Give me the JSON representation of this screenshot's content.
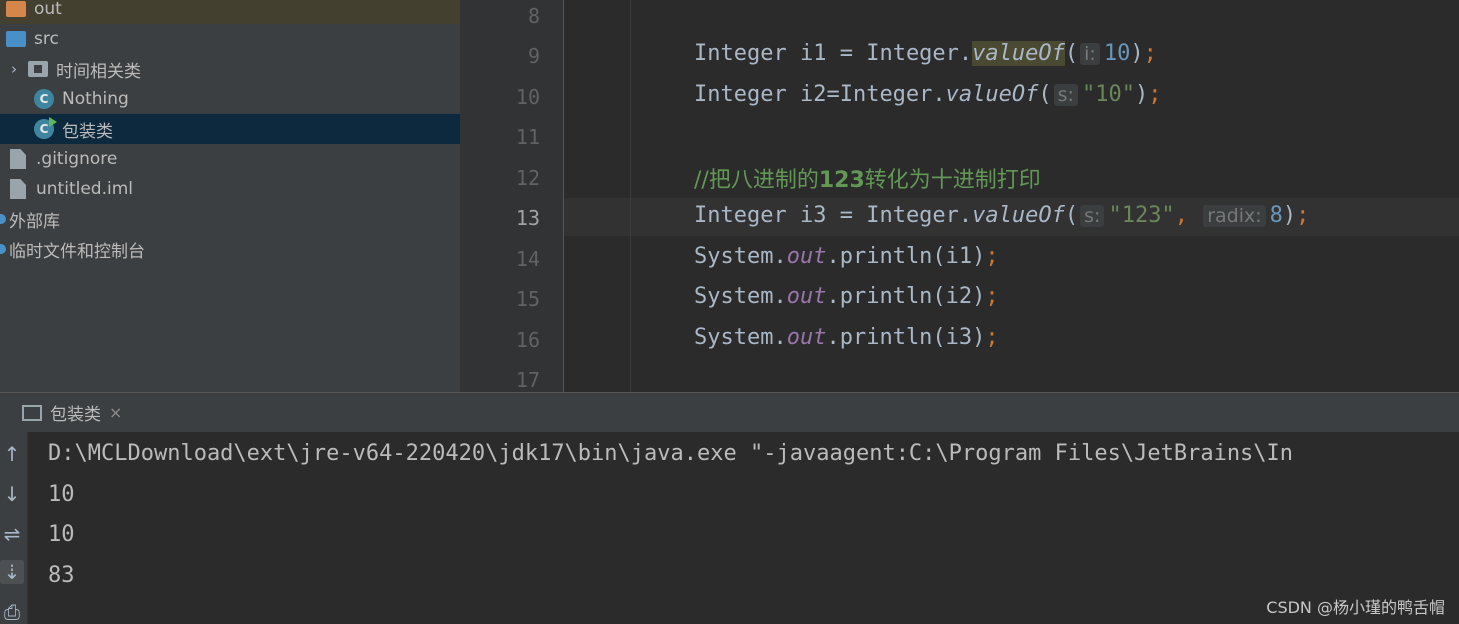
{
  "project_tree": {
    "items": [
      {
        "label": "out"
      },
      {
        "label": "src"
      },
      {
        "label": "时间相关类"
      },
      {
        "label": "Nothing",
        "icon_letter": "C"
      },
      {
        "label": "包装类",
        "icon_letter": "C"
      },
      {
        "label": ".gitignore"
      },
      {
        "label": "untitled.iml"
      },
      {
        "label": "外部库"
      },
      {
        "label": "临时文件和控制台"
      }
    ]
  },
  "editor": {
    "line_numbers": [
      "8",
      "9",
      "10",
      "11",
      "12",
      "13",
      "14",
      "15",
      "16",
      "17"
    ],
    "current_line": "13",
    "lines": {
      "l9": {
        "type": "Integer",
        "var": " i1 = ",
        "cls": "Integer.",
        "method": "valueOf",
        "open": "(",
        "hint": "i:",
        "arg": "10",
        "close": ")",
        "semi": ";"
      },
      "l10": {
        "type": "Integer",
        "var": " i2=",
        "cls": "Integer.",
        "method": "valueOf",
        "open": "(",
        "hint": "s:",
        "arg": "\"10\"",
        "close": ")",
        "semi": ";"
      },
      "l12": {
        "comment_prefix": "//把八进制的",
        "comment_num": "123",
        "comment_suffix": "转化为十进制打印"
      },
      "l13": {
        "type": "Integer",
        "var": " i3 = ",
        "cls": "Integer.",
        "method": "valueOf",
        "open": "(",
        "hint": "s:",
        "arg": "\"123\"",
        "comma": ",",
        "hint2": "radix:",
        "arg2": "8",
        "close": ")",
        "semi": ";"
      },
      "l14": {
        "sys": "System.",
        "field": "out",
        "call": ".println(i1)",
        "semi": ";"
      },
      "l15": {
        "sys": "System.",
        "field": "out",
        "call": ".println(i2)",
        "semi": ";"
      },
      "l16": {
        "sys": "System.",
        "field": "out",
        "call": ".println(i3)",
        "semi": ";"
      }
    }
  },
  "run_window": {
    "tab_label": "包装类",
    "close_glyph": "×",
    "toolbar_icons": [
      "↑",
      "↓",
      "⇌",
      "⇣",
      "⎙"
    ],
    "output": [
      "D:\\MCLDownload\\ext\\jre-v64-220420\\jdk17\\bin\\java.exe \"-javaagent:C:\\Program Files\\JetBrains\\In",
      "10",
      "10",
      "83"
    ]
  },
  "watermark": "CSDN @杨小瑾的鸭舌帽",
  "colors": {
    "keyword": "#cc7832",
    "number": "#6897bb",
    "string": "#6a8759",
    "comment": "#629755",
    "static_field": "#9876aa",
    "selection": "#0d293e"
  }
}
